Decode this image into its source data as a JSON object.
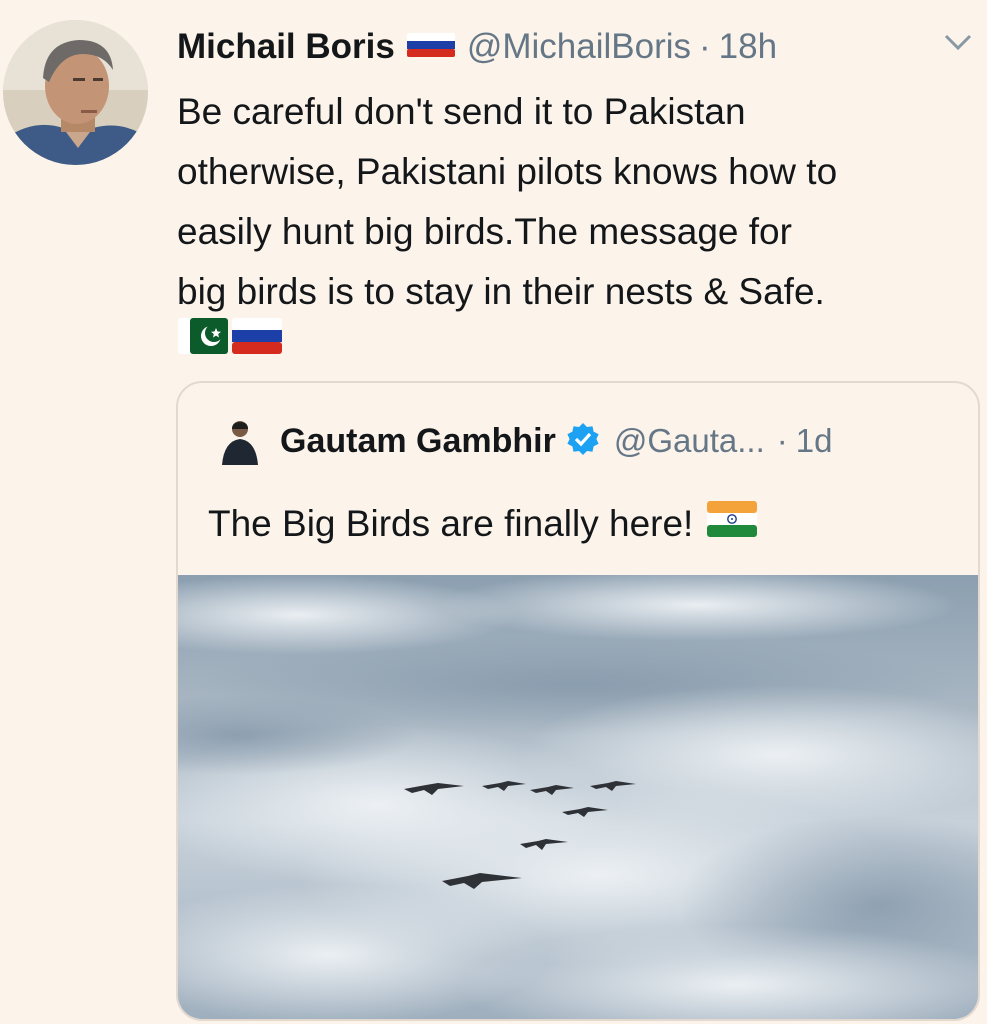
{
  "tweet": {
    "author_name": "Michail Boris",
    "author_flag": "russia-flag-icon",
    "handle": "@MichailBoris",
    "separator": "·",
    "time": "18h",
    "menu_icon": "chevron-down-icon",
    "text_lines": [
      "Be careful don't send it to Pakistan",
      "otherwise, Pakistani pilots knows how to",
      "easily hunt big birds.The message for",
      "big birds is to stay in their nests & Safe."
    ],
    "emojis": [
      "pakistan-flag-icon",
      "russia-flag-icon"
    ]
  },
  "quoted_tweet": {
    "author_name": "Gautam Gambhir",
    "verified_icon": "verified-badge-icon",
    "handle": "@Gauta...",
    "separator": "·",
    "time": "1d",
    "text": "The Big Birds are finally here!",
    "text_emoji": "india-flag-icon",
    "media": "photo-of-jet-formation-above-clouds"
  },
  "colors": {
    "background": "#fcf3ea",
    "text_primary": "#14171a",
    "text_secondary": "#657786",
    "verified_blue": "#1da1f2",
    "card_border": "#e3d9cf"
  }
}
